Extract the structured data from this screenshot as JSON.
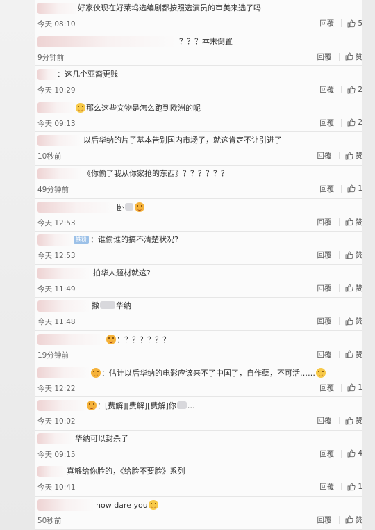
{
  "reply_label": "回覆",
  "comments": [
    {
      "text": "好家伙现在好莱坞选编剧都按照选演员的审美来选了吗",
      "time": "今天 08:10",
      "likes": "5",
      "likes_zero": "赞"
    },
    {
      "text": "？？？本末倒置",
      "time": "9分钟前",
      "likes": "赞"
    },
    {
      "text": "：这几个亚裔更贱",
      "time": "今天 10:29",
      "likes": "2"
    },
    {
      "text": "那么这些文物是怎么跑到欧洲的呢",
      "time": "今天 09:13",
      "likes": "2"
    },
    {
      "text": "以后华纳的片子基本告别国内市场了，就这肯定不让引进了",
      "time": "10秒前",
      "likes": "赞"
    },
    {
      "text": "《你偷了我从你家抢的东西》？？？？？？",
      "time": "49分钟前",
      "likes": "1"
    },
    {
      "text": "卧",
      "time": "今天 12:53",
      "likes": "赞"
    },
    {
      "text": "谁偷谁的搞不清楚状况?",
      "badge": "铁粉",
      "time": "今天 12:53",
      "likes": "赞"
    },
    {
      "text": "拍华人题材就这?",
      "time": "今天 11:49",
      "likes": "赞"
    },
    {
      "text": "撒",
      "text_tail": "华纳",
      "time": "今天 11:48",
      "likes": "赞"
    },
    {
      "text": "：？？？？？？",
      "time": "19分钟前",
      "likes": "赞"
    },
    {
      "text": "：估计以后华纳的电影应该来不了中国了，自作孽，不可活……",
      "time": "今天 12:22",
      "likes": "1"
    },
    {
      "text": "：[费解][费解][费解]你",
      "text_tail": "…",
      "time": "今天 10:02",
      "likes": "赞"
    },
    {
      "text": "华纳可以封杀了",
      "time": "今天 09:15",
      "likes": "4"
    },
    {
      "text": "真够给你脸的，《给脸不要脸》系列",
      "time": "今天 10:41",
      "likes": "1"
    },
    {
      "text": "how dare you",
      "time": "50秒前",
      "likes": "赞"
    }
  ]
}
